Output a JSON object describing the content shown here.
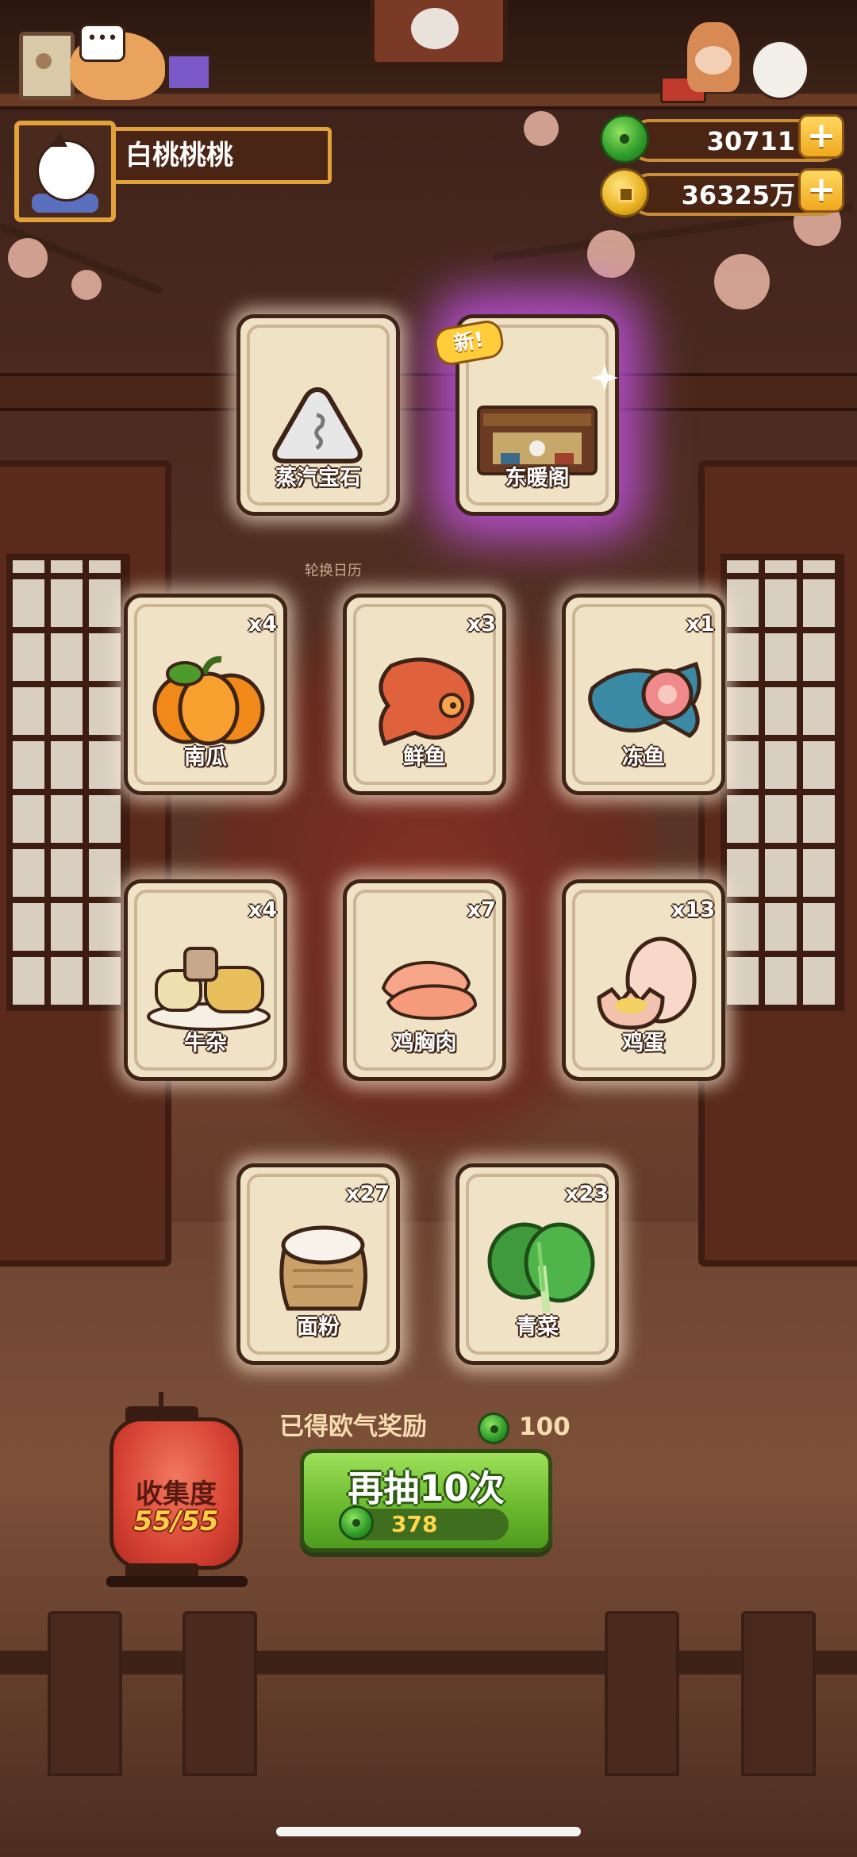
{
  "player": {
    "name": "白桃桃桃"
  },
  "currency": {
    "jade": "30711",
    "coins": "36325万"
  },
  "new_badge": "新!",
  "wall_sign": "轮换日历",
  "cards": [
    {
      "label": "蒸汽宝石",
      "qty": "",
      "icon": "steam-gem-icon"
    },
    {
      "label": "东暖阁",
      "qty": "",
      "icon": "east-warm-pavilion-icon",
      "highlight": "purple-glow"
    },
    {
      "label": "南瓜",
      "qty": "x4",
      "icon": "pumpkin-icon"
    },
    {
      "label": "鲜鱼",
      "qty": "x3",
      "icon": "fresh-fish-icon"
    },
    {
      "label": "冻鱼",
      "qty": "x1",
      "icon": "frozen-fish-icon"
    },
    {
      "label": "牛杂",
      "qty": "x4",
      "icon": "beef-offal-icon"
    },
    {
      "label": "鸡胸肉",
      "qty": "x7",
      "icon": "chicken-breast-icon"
    },
    {
      "label": "鸡蛋",
      "qty": "x13",
      "icon": "egg-icon"
    },
    {
      "label": "面粉",
      "qty": "x27",
      "icon": "flour-sack-icon"
    },
    {
      "label": "青菜",
      "qty": "x23",
      "icon": "green-vegetable-icon"
    }
  ],
  "reward": {
    "text": "已得欧气奖励",
    "value": "100"
  },
  "draw_button": {
    "label": "再抽10次",
    "cost": "378"
  },
  "collection": {
    "title": "收集度",
    "count": "55/55"
  },
  "colors": {
    "draw_button": "#6cba2f",
    "purple_glow": "#d25aff",
    "lantern": "#d84434",
    "gold_border": "#e2a23b"
  }
}
